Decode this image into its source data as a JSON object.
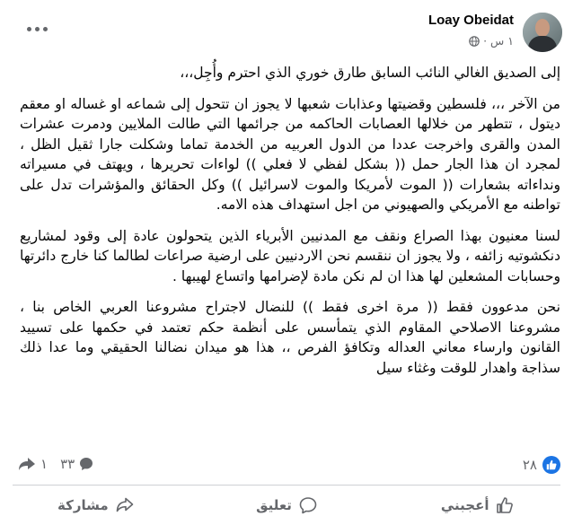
{
  "post": {
    "author": "Loay Obeidat",
    "time": "١ س",
    "dot": "·",
    "paragraphs": [
      "إلى الصديق الغالي النائب السابق طارق خوري الذي احترم وأُجِل،،،",
      "من الآخر ،،، فلسطين وقضيتها وعذابات شعبها لا يجوز ان تتحول إلى شماعه او غساله او معقم ديتول ، تتطهر من خلالها العصابات الحاكمه من جرائمها التي طالت الملايين ودمرت عشرات المدن والقرى واخرجت عددا من الدول العربيه من الخدمة تماما وشكلت جارا ثقيل الظل ، لمجرد ان هذا الجار حمل (( بشكل لفظي لا فعلي )) لواءات تحريرها ، ويهتف في مسيراته ونداءاته بشعارات (( الموت لأمريكا والموت لاسرائيل )) وكل الحقائق والمؤشرات تدل على تواطنه مع الأمريكي والصهيوني من اجل استهداف هذه الامه.",
      "لسنا معنيون بهذا الصراع ونقف مع المدنيين الأبرياء الذين يتحولون عادة إلى وقود لمشاريع دنكشوتيه زائفه ، ولا يجوز ان ننقسم نحن الاردنيين على ارضية صراعات لطالما كنا خارج دائرتها وحسابات المشعلين لها هذا ان لم نكن مادة لإضرامها واتساع لهيبها .",
      "نحن مدعوون فقط (( مرة اخرى فقط )) للنضال لاجتراح مشروعنا العربي الخاص بنا ، مشروعنا الاصلاحي المقاوم الذي يتمأسس على أنظمة حكم تعتمد في حكمها على تسييد القانون وارساء معاني العداله وتكافؤ الفرص ،، هذا هو ميدان نضالنا الحقيقي وما عدا ذلك سذاجة واهدار للوقت وغثاء سيل"
    ]
  },
  "stats": {
    "likes": "٢٨",
    "comments": "٣٣",
    "shares": "١"
  },
  "actions": {
    "like": "أعجبني",
    "comment": "تعليق",
    "share": "مشاركة"
  },
  "icons": {
    "more": "more-dots-icon",
    "globe": "globe-icon",
    "like": "thumbs-up-icon",
    "comment": "comment-bubble-icon",
    "share": "share-arrow-icon"
  },
  "colors": {
    "accent": "#1b74e4",
    "secondary_text": "#65676b",
    "text": "#050505"
  }
}
